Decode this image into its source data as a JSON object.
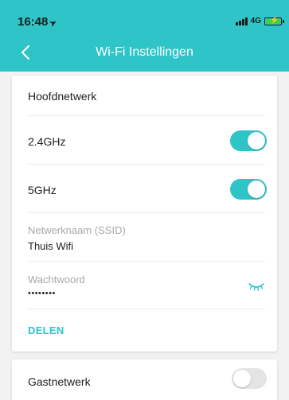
{
  "status_bar": {
    "time": "16:48",
    "network": "4G"
  },
  "header": {
    "title": "Wi-Fi Instellingen",
    "back_icon": "chevron-left-icon"
  },
  "main_network": {
    "section_title": "Hoofdnetwerk",
    "band_24": {
      "label": "2.4GHz",
      "enabled": true
    },
    "band_5": {
      "label": "5GHz",
      "enabled": true
    },
    "ssid": {
      "label": "Netwerknaam (SSID)",
      "value": "Thuis Wifi"
    },
    "password": {
      "label": "Wachtwoord",
      "value": "••••••••",
      "icon": "eye-closed-icon"
    },
    "share_label": "DELEN"
  },
  "guest_network": {
    "label": "Gastnetwerk",
    "enabled": false
  },
  "colors": {
    "accent": "#2ec4c8",
    "toggle_off": "#e4e4e4"
  }
}
